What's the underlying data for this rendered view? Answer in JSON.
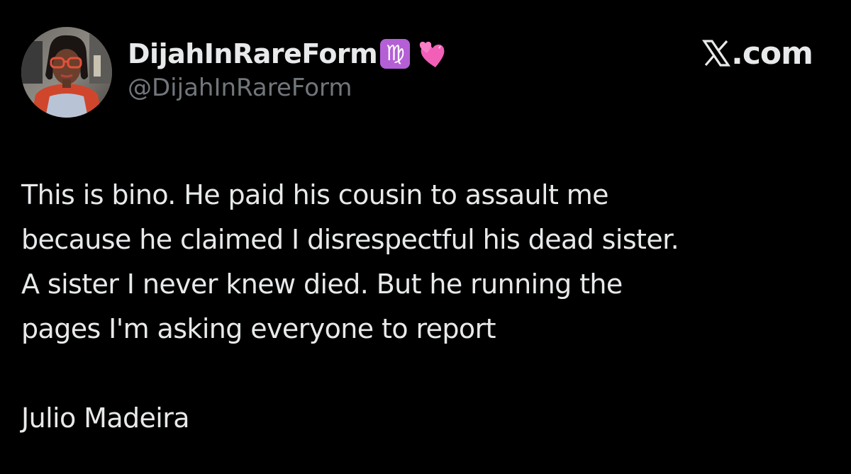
{
  "author": {
    "display_name": "DijahInRareForm",
    "handle": "@DijahInRareForm",
    "zodiac_badge": "♍",
    "zodiac_badge_icon": "virgo-icon",
    "emoji_icon": "two-hearts-icon",
    "avatar_icon": "profile-photo"
  },
  "brand": {
    "logo_icon": "x-logo-icon",
    "suffix": ".com"
  },
  "tweet": {
    "lines": [
      "This is bino. He paid his cousin to assault me",
      "because he claimed I disrespectful his dead sister.",
      "A sister I never knew died. But he running the",
      "pages I'm asking everyone to report"
    ],
    "signature": "Julio Madeira"
  },
  "colors": {
    "background": "#000000",
    "text_primary": "#e7e9ea",
    "text_secondary": "#71767b",
    "badge_purple": "#b45fd6",
    "heart_pink": "#f25fb7"
  }
}
